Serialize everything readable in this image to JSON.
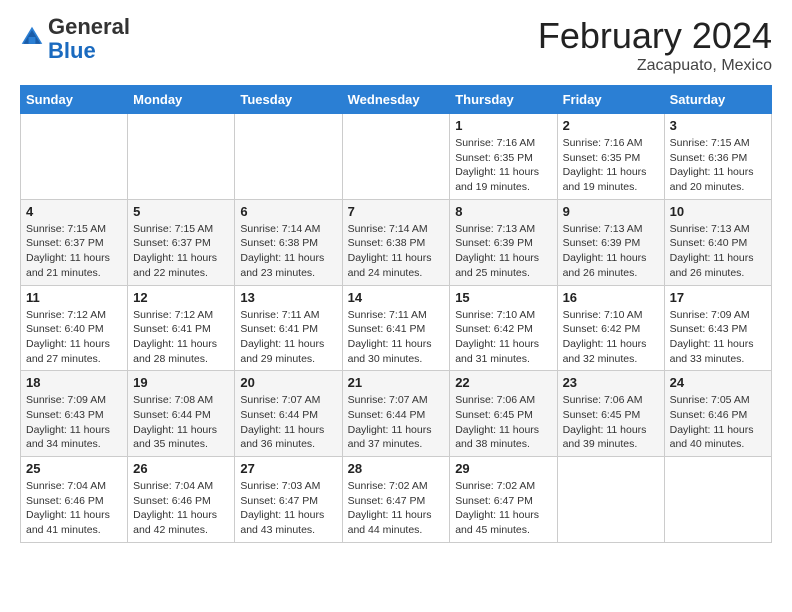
{
  "header": {
    "logo_general": "General",
    "logo_blue": "Blue",
    "month_title": "February 2024",
    "subtitle": "Zacapuato, Mexico"
  },
  "days_of_week": [
    "Sunday",
    "Monday",
    "Tuesday",
    "Wednesday",
    "Thursday",
    "Friday",
    "Saturday"
  ],
  "weeks": [
    [
      {
        "num": "",
        "info": ""
      },
      {
        "num": "",
        "info": ""
      },
      {
        "num": "",
        "info": ""
      },
      {
        "num": "",
        "info": ""
      },
      {
        "num": "1",
        "info": "Sunrise: 7:16 AM\nSunset: 6:35 PM\nDaylight: 11 hours and 19 minutes."
      },
      {
        "num": "2",
        "info": "Sunrise: 7:16 AM\nSunset: 6:35 PM\nDaylight: 11 hours and 19 minutes."
      },
      {
        "num": "3",
        "info": "Sunrise: 7:15 AM\nSunset: 6:36 PM\nDaylight: 11 hours and 20 minutes."
      }
    ],
    [
      {
        "num": "4",
        "info": "Sunrise: 7:15 AM\nSunset: 6:37 PM\nDaylight: 11 hours and 21 minutes."
      },
      {
        "num": "5",
        "info": "Sunrise: 7:15 AM\nSunset: 6:37 PM\nDaylight: 11 hours and 22 minutes."
      },
      {
        "num": "6",
        "info": "Sunrise: 7:14 AM\nSunset: 6:38 PM\nDaylight: 11 hours and 23 minutes."
      },
      {
        "num": "7",
        "info": "Sunrise: 7:14 AM\nSunset: 6:38 PM\nDaylight: 11 hours and 24 minutes."
      },
      {
        "num": "8",
        "info": "Sunrise: 7:13 AM\nSunset: 6:39 PM\nDaylight: 11 hours and 25 minutes."
      },
      {
        "num": "9",
        "info": "Sunrise: 7:13 AM\nSunset: 6:39 PM\nDaylight: 11 hours and 26 minutes."
      },
      {
        "num": "10",
        "info": "Sunrise: 7:13 AM\nSunset: 6:40 PM\nDaylight: 11 hours and 26 minutes."
      }
    ],
    [
      {
        "num": "11",
        "info": "Sunrise: 7:12 AM\nSunset: 6:40 PM\nDaylight: 11 hours and 27 minutes."
      },
      {
        "num": "12",
        "info": "Sunrise: 7:12 AM\nSunset: 6:41 PM\nDaylight: 11 hours and 28 minutes."
      },
      {
        "num": "13",
        "info": "Sunrise: 7:11 AM\nSunset: 6:41 PM\nDaylight: 11 hours and 29 minutes."
      },
      {
        "num": "14",
        "info": "Sunrise: 7:11 AM\nSunset: 6:41 PM\nDaylight: 11 hours and 30 minutes."
      },
      {
        "num": "15",
        "info": "Sunrise: 7:10 AM\nSunset: 6:42 PM\nDaylight: 11 hours and 31 minutes."
      },
      {
        "num": "16",
        "info": "Sunrise: 7:10 AM\nSunset: 6:42 PM\nDaylight: 11 hours and 32 minutes."
      },
      {
        "num": "17",
        "info": "Sunrise: 7:09 AM\nSunset: 6:43 PM\nDaylight: 11 hours and 33 minutes."
      }
    ],
    [
      {
        "num": "18",
        "info": "Sunrise: 7:09 AM\nSunset: 6:43 PM\nDaylight: 11 hours and 34 minutes."
      },
      {
        "num": "19",
        "info": "Sunrise: 7:08 AM\nSunset: 6:44 PM\nDaylight: 11 hours and 35 minutes."
      },
      {
        "num": "20",
        "info": "Sunrise: 7:07 AM\nSunset: 6:44 PM\nDaylight: 11 hours and 36 minutes."
      },
      {
        "num": "21",
        "info": "Sunrise: 7:07 AM\nSunset: 6:44 PM\nDaylight: 11 hours and 37 minutes."
      },
      {
        "num": "22",
        "info": "Sunrise: 7:06 AM\nSunset: 6:45 PM\nDaylight: 11 hours and 38 minutes."
      },
      {
        "num": "23",
        "info": "Sunrise: 7:06 AM\nSunset: 6:45 PM\nDaylight: 11 hours and 39 minutes."
      },
      {
        "num": "24",
        "info": "Sunrise: 7:05 AM\nSunset: 6:46 PM\nDaylight: 11 hours and 40 minutes."
      }
    ],
    [
      {
        "num": "25",
        "info": "Sunrise: 7:04 AM\nSunset: 6:46 PM\nDaylight: 11 hours and 41 minutes."
      },
      {
        "num": "26",
        "info": "Sunrise: 7:04 AM\nSunset: 6:46 PM\nDaylight: 11 hours and 42 minutes."
      },
      {
        "num": "27",
        "info": "Sunrise: 7:03 AM\nSunset: 6:47 PM\nDaylight: 11 hours and 43 minutes."
      },
      {
        "num": "28",
        "info": "Sunrise: 7:02 AM\nSunset: 6:47 PM\nDaylight: 11 hours and 44 minutes."
      },
      {
        "num": "29",
        "info": "Sunrise: 7:02 AM\nSunset: 6:47 PM\nDaylight: 11 hours and 45 minutes."
      },
      {
        "num": "",
        "info": ""
      },
      {
        "num": "",
        "info": ""
      }
    ]
  ]
}
